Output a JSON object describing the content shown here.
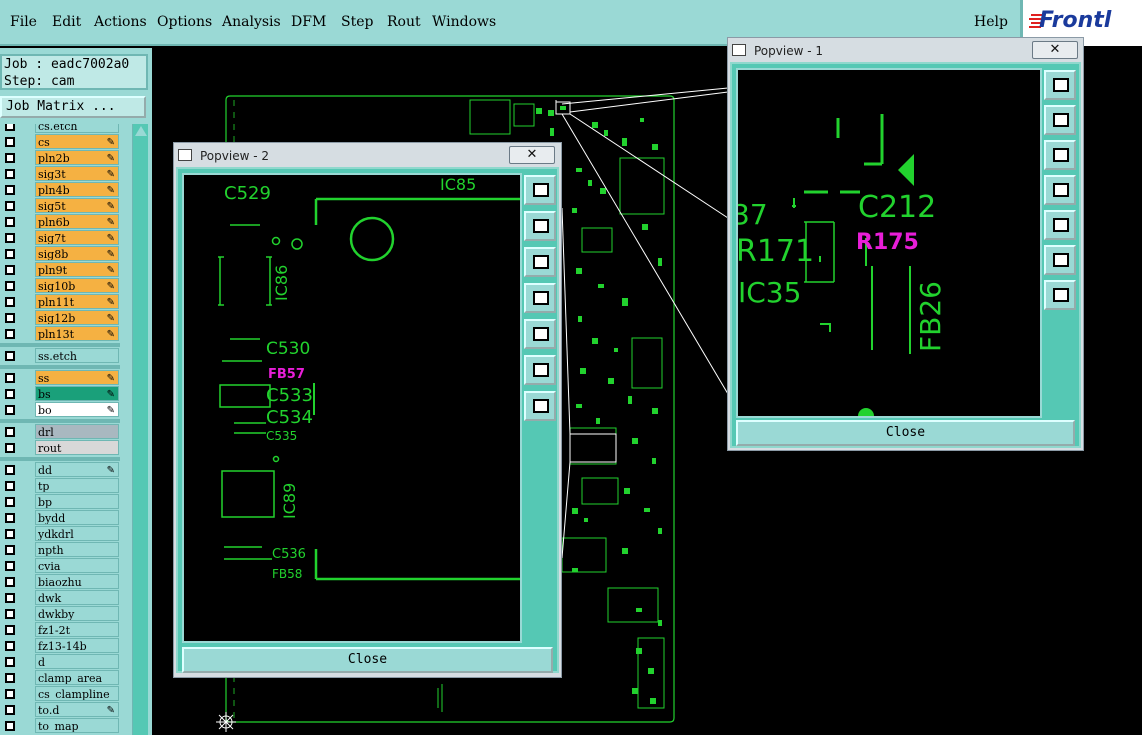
{
  "menubar": {
    "items": [
      "File",
      "Edit",
      "Actions",
      "Options",
      "Analysis",
      "DFM",
      "Step",
      "Rout",
      "Windows"
    ],
    "help": "Help",
    "logo": "Frontl"
  },
  "job": {
    "job_label": "Job : eadc7002a0",
    "step_label": "Step: cam"
  },
  "job_matrix": "Job Matrix ...",
  "layers": [
    {
      "name": "cs.etch",
      "color": "#9ad9d5"
    },
    {
      "name": "cs",
      "color": "#f5b142",
      "pen": true
    },
    {
      "name": "pln2b",
      "color": "#f5b142",
      "pen": true
    },
    {
      "name": "sig3t",
      "color": "#f5b142",
      "pen": true
    },
    {
      "name": "pln4b",
      "color": "#f5b142",
      "pen": true
    },
    {
      "name": "sig5t",
      "color": "#f5b142",
      "pen": true
    },
    {
      "name": "pln6b",
      "color": "#f5b142",
      "pen": true
    },
    {
      "name": "sig7t",
      "color": "#f5b142",
      "pen": true
    },
    {
      "name": "sig8b",
      "color": "#f5b142",
      "pen": true
    },
    {
      "name": "pln9t",
      "color": "#f5b142",
      "pen": true
    },
    {
      "name": "sig10b",
      "color": "#f5b142",
      "pen": true
    },
    {
      "name": "pln11t",
      "color": "#f5b142",
      "pen": true
    },
    {
      "name": "sig12b",
      "color": "#f5b142",
      "pen": true
    },
    {
      "name": "pln13t",
      "color": "#f5b142",
      "pen": true
    },
    {
      "name": "ss.etch",
      "color": "#9ad9d5"
    },
    {
      "name": "ss",
      "color": "#f5b142",
      "pen": true
    },
    {
      "name": "bs",
      "color": "#1aa07a",
      "pen": true
    },
    {
      "name": "bo",
      "color": "#ffffff",
      "pen": true
    },
    {
      "name": "drl",
      "color": "#a9b8c0"
    },
    {
      "name": "rout",
      "color": "#d8d8d8"
    },
    {
      "name": "dd",
      "color": "#9ad9d5",
      "pen": true
    },
    {
      "name": "tp",
      "color": "#9ad9d5"
    },
    {
      "name": "bp",
      "color": "#9ad9d5"
    },
    {
      "name": "bydd",
      "color": "#9ad9d5"
    },
    {
      "name": "ydkdrl",
      "color": "#9ad9d5"
    },
    {
      "name": "npth",
      "color": "#9ad9d5"
    },
    {
      "name": "cvia",
      "color": "#9ad9d5"
    },
    {
      "name": "biaozhu",
      "color": "#9ad9d5"
    },
    {
      "name": "dwk",
      "color": "#9ad9d5"
    },
    {
      "name": "dwkby",
      "color": "#9ad9d5"
    },
    {
      "name": "fz1-2t",
      "color": "#9ad9d5"
    },
    {
      "name": "fz13-14b",
      "color": "#9ad9d5"
    },
    {
      "name": "d",
      "color": "#9ad9d5"
    },
    {
      "name": "clamp_area",
      "color": "#9ad9d5"
    },
    {
      "name": "cs_clampline",
      "color": "#9ad9d5"
    },
    {
      "name": "to.d",
      "color": "#9ad9d5",
      "pen": true
    },
    {
      "name": "to_map",
      "color": "#9ad9d5"
    }
  ],
  "popview1": {
    "title": "Popview - 1",
    "close_x": "✕",
    "close": "Close",
    "labels": [
      "C212",
      "R171",
      "R175",
      "IC35",
      "FB26",
      "37"
    ]
  },
  "popview2": {
    "title": "Popview - 2",
    "close_x": "✕",
    "close": "Close",
    "labels": [
      "C529",
      "IC85",
      "IC86",
      "C530",
      "FB57",
      "C533",
      "C534",
      "C535",
      "IC89",
      "C536",
      "FB58"
    ]
  },
  "colors": {
    "panel": "#9ad9d5",
    "accent": "#55c8b4",
    "trace": "#22d22e",
    "highlight": "#e81ed8",
    "layer_active": "#f5b142"
  },
  "icons": [
    "window-icon",
    "close-icon",
    "zoom-icon",
    "pan-up-icon",
    "pan-down-icon",
    "pan-left-icon",
    "pan-right-icon",
    "zoom-out-icon",
    "fit-icon",
    "pen-icon"
  ]
}
